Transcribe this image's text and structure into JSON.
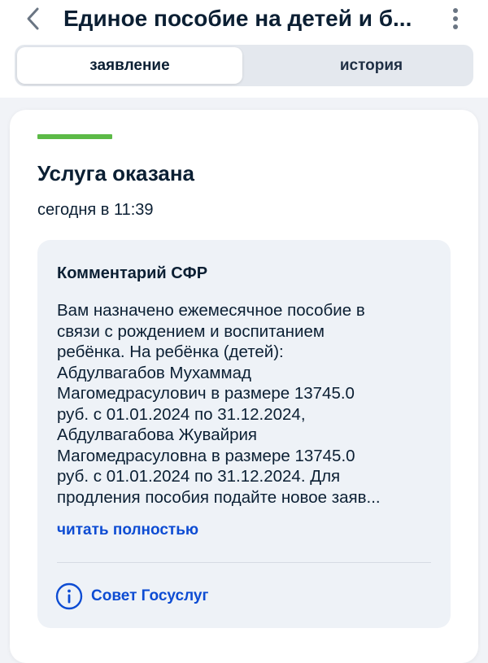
{
  "header": {
    "title": "Единое пособие на детей и б..."
  },
  "tabs": [
    {
      "label": "заявление",
      "active": true
    },
    {
      "label": "история",
      "active": false
    }
  ],
  "status": {
    "title": "Услуга оказана",
    "time": "сегодня в 11:39",
    "color": "#5cba47"
  },
  "comment": {
    "title": "Комментарий СФР",
    "lines": [
      "Вам назначено ежемесячное пособие в",
      "связи с рождением и воспитанием",
      "ребёнка. На ребёнка (детей):",
      "Абдулвагабов Мухаммад",
      "Магомедрасулович в размере 13745.0",
      "руб. с 01.01.2024 по 31.12.2024,",
      "Абдулвагабова Жувайрия",
      "Магомедрасуловна в размере 13745.0",
      "руб. с 01.01.2024 по 31.12.2024. Для",
      "продления пособия подайте новое заяв..."
    ],
    "read_more": "читать полностью"
  },
  "tip": {
    "label": "Совет Госуслуг",
    "icon": "info-icon"
  },
  "colors": {
    "accent": "#0d4cd3",
    "text": "#0b1f33",
    "background": "#f1f3f7",
    "comment_bg": "#eef2f7"
  }
}
